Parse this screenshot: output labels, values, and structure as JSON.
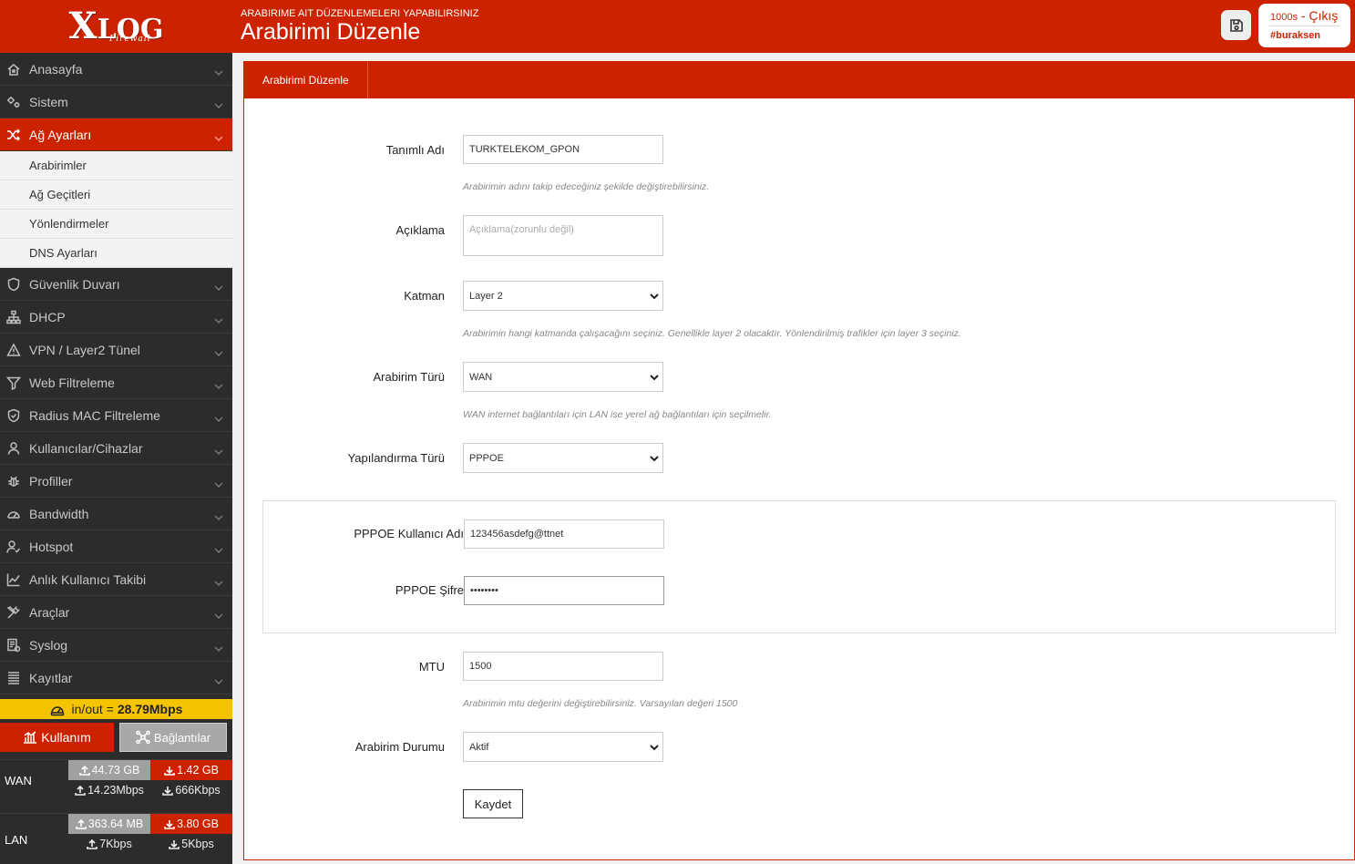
{
  "brand": {
    "name_big": "X",
    "name_rest": "LOG",
    "sub": "Firewall"
  },
  "header": {
    "crumb": "ARABIRIME AIT DÜZENLEMELERI YAPABILIRSINIZ",
    "title": "Arabirimi Düzenle",
    "timer": "1000s",
    "exit_label": " - Çıkış",
    "user": "#buraksen"
  },
  "sidebar": {
    "items": [
      {
        "label": "Anasayfa",
        "icon": "home-icon"
      },
      {
        "label": "Sistem",
        "icon": "gears-icon"
      },
      {
        "label": "Ağ Ayarları",
        "icon": "shuffle-icon",
        "active": true
      },
      {
        "label": "Güvenlik Duvarı",
        "icon": "shield-icon"
      },
      {
        "label": "DHCP",
        "icon": "network-icon"
      },
      {
        "label": "VPN / Layer2 Tünel",
        "icon": "warning-icon"
      },
      {
        "label": "Web Filtreleme",
        "icon": "filter-icon"
      },
      {
        "label": "Radius MAC Filtreleme",
        "icon": "shield-check-icon"
      },
      {
        "label": "Kullanıcılar/Cihazlar",
        "icon": "user-icon"
      },
      {
        "label": "Profiller",
        "icon": "bug-icon"
      },
      {
        "label": "Bandwidth",
        "icon": "gauge-icon"
      },
      {
        "label": "Hotspot",
        "icon": "user-check-icon"
      },
      {
        "label": "Anlık Kullanıcı Takibi",
        "icon": "line-chart-icon"
      },
      {
        "label": "Araçlar",
        "icon": "tools-icon"
      },
      {
        "label": "Syslog",
        "icon": "log-icon"
      },
      {
        "label": "Kayıtlar",
        "icon": "list-icon"
      }
    ],
    "submenu": [
      "Arabirimler",
      "Ağ Geçitleri",
      "Yönlendirmeler",
      "DNS Ayarları"
    ],
    "traffic_label": "in/out = ",
    "traffic_value": "28.79Mbps",
    "tab_usage": "Kullanım",
    "tab_connections": "Bağlantılar",
    "stats": [
      {
        "name": "WAN",
        "up_total": "44.73 GB",
        "down_total": "1.42 GB",
        "up_rate": "14.23Mbps",
        "down_rate": "666Kbps"
      },
      {
        "name": "LAN",
        "up_total": "363.64 MB",
        "down_total": "3.80 GB",
        "up_rate": "7Kbps",
        "down_rate": "5Kbps"
      }
    ]
  },
  "form": {
    "tab_label": "Arabirimi Düzenle",
    "name_label": "Tanımlı Adı",
    "name_value": "TURKTELEKOM_GPON",
    "name_help": "Arabirimin adını takip edeceğiniz şekilde değiştirebilirsiniz.",
    "desc_label": "Açıklama",
    "desc_placeholder": "Açıklama(zorunlu değil)",
    "layer_label": "Katman",
    "layer_value": "Layer 2",
    "layer_help": "Arabirimin hangi katmanda çalışacağını seçiniz. Genellikle layer 2 olacaktır. Yönlendirilmiş trafikler için layer 3 seçiniz.",
    "type_label": "Arabirim Türü",
    "type_value": "WAN",
    "type_help": "WAN internet bağlantıları için LAN ise yerel ağ bağlantıları için seçilmelir.",
    "config_label": "Yapılandırma Türü",
    "config_value": "PPPOE",
    "pppoe_user_label": "PPPOE Kullanıcı Adı",
    "pppoe_user_value": "123456asdefg@ttnet",
    "pppoe_pass_label": "PPPOE Şifre",
    "pppoe_pass_value": "••••••••",
    "mtu_label": "MTU",
    "mtu_value": "1500",
    "mtu_help": "Arabirimin mtu değerini değiştirebilirsiniz. Varsayılan değeri 1500",
    "status_label": "Arabirim Durumu",
    "status_value": "Aktif",
    "submit_label": "Kaydet"
  },
  "colors": {
    "accent": "#cc2200",
    "sidebar_bg": "#2c2c2c",
    "traffic_bg": "#f5c400"
  }
}
